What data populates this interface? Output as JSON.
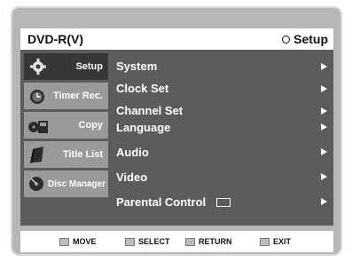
{
  "header": {
    "title": "DVD-R(V)",
    "mode_label": "Setup"
  },
  "sidebar": {
    "items": [
      {
        "label": "Setup",
        "icon": "gear-icon",
        "active": true
      },
      {
        "label": "Timer Rec.",
        "icon": "clock-icon",
        "active": false
      },
      {
        "label": "Copy",
        "icon": "copy-icon",
        "active": false
      },
      {
        "label": "Title List",
        "icon": "list-icon",
        "active": false
      },
      {
        "label": "Disc Manager",
        "icon": "disc-icon",
        "active": false
      }
    ]
  },
  "menu": {
    "items": [
      {
        "label": "System"
      },
      {
        "label": "Clock Set"
      },
      {
        "label": "Channel Set"
      },
      {
        "label": "Language"
      },
      {
        "label": "Audio"
      },
      {
        "label": "Video"
      },
      {
        "label": "Parental Control"
      }
    ]
  },
  "footer": {
    "move_label": "MOVE",
    "select_label": "SELECT",
    "return_label": "RETURN",
    "exit_label": "EXIT"
  },
  "colors": {
    "panel": "#5c5c5c",
    "frame": "#b6b6b6",
    "active_tab": "#373737",
    "inactive_tab": "#9a9a9a"
  }
}
